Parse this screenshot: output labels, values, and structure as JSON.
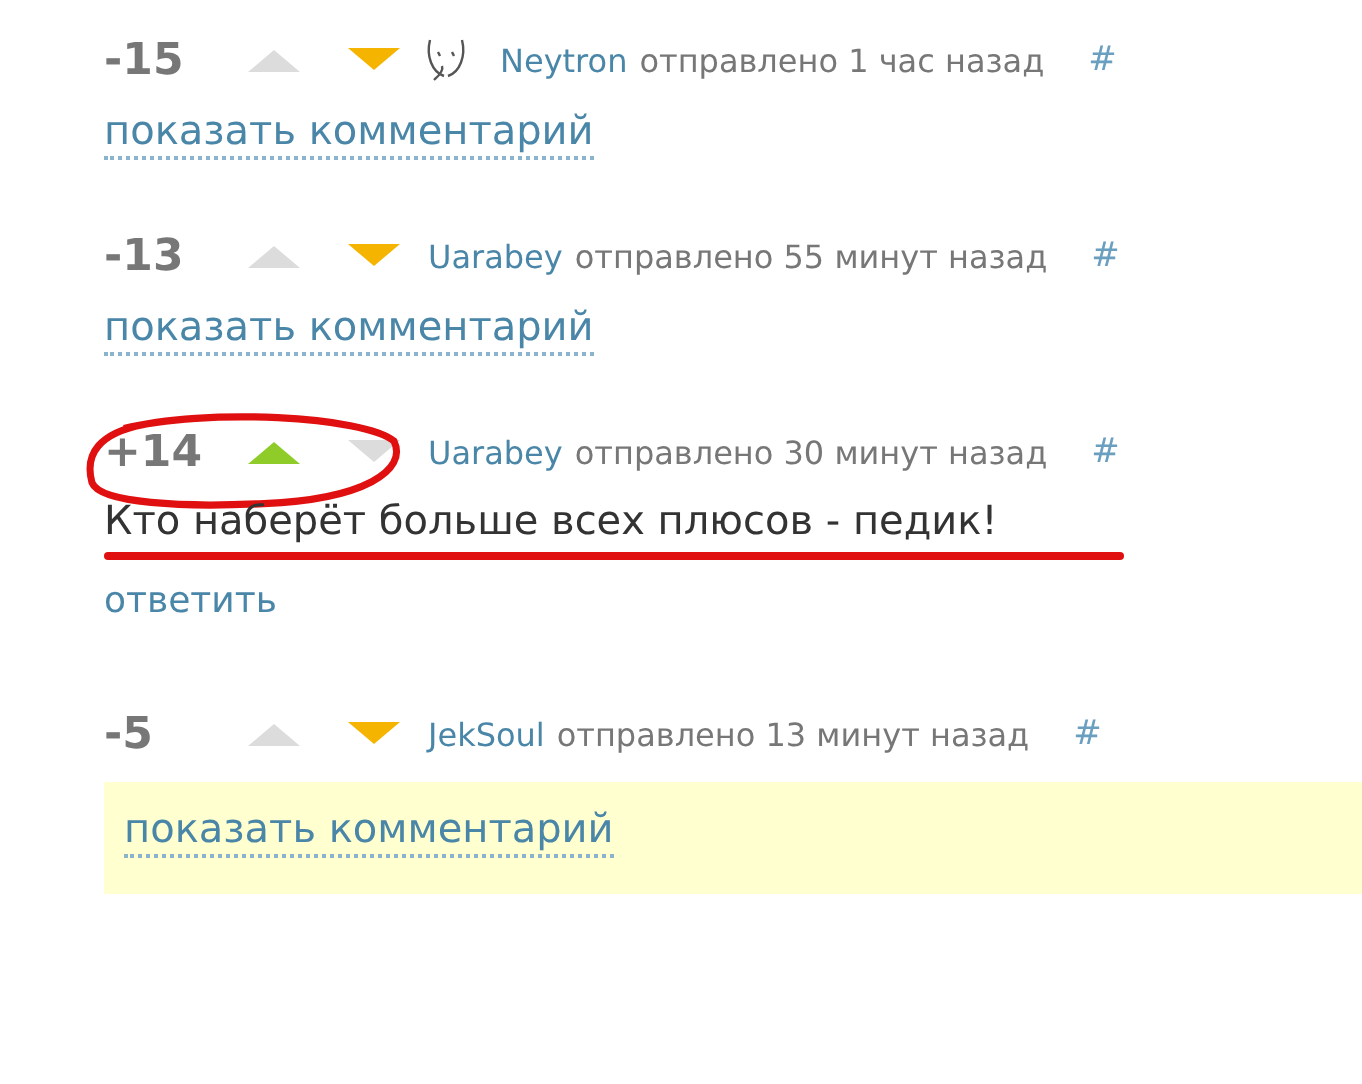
{
  "comments": [
    {
      "rating": "-15",
      "upvoted": false,
      "downvoted": true,
      "avatar": true,
      "author": "Neytron",
      "time": "отправлено 1 час назад",
      "hash": "#",
      "collapsed": true,
      "link": "показать комментарий",
      "highlighted": false,
      "annotated": false
    },
    {
      "rating": "-13",
      "upvoted": false,
      "downvoted": true,
      "avatar": false,
      "author": "Uarabey",
      "time": "отправлено 55 минут назад",
      "hash": "#",
      "collapsed": true,
      "link": "показать комментарий",
      "highlighted": false,
      "annotated": false
    },
    {
      "rating": "+14",
      "upvoted": true,
      "downvoted": false,
      "avatar": false,
      "author": "Uarabey",
      "time": "отправлено 30 минут назад",
      "hash": "#",
      "collapsed": false,
      "text": "Кто наберёт больше всех плюсов - педик!",
      "link": "ответить",
      "highlighted": false,
      "annotated": true
    },
    {
      "rating": "-5",
      "upvoted": false,
      "downvoted": true,
      "avatar": false,
      "author": "JekSoul",
      "time": "отправлено 13 минут назад",
      "hash": "#",
      "collapsed": true,
      "link": "показать комментарий",
      "highlighted": true,
      "annotated": false
    }
  ]
}
